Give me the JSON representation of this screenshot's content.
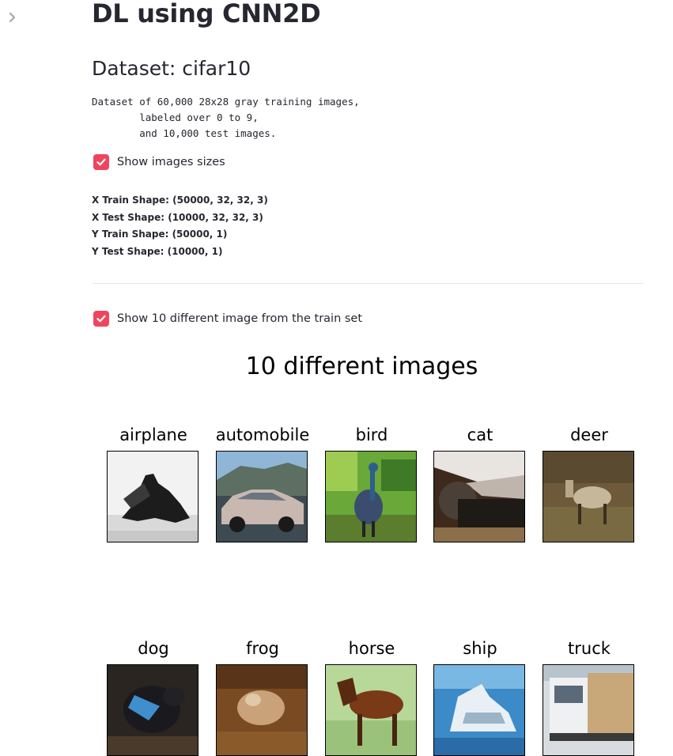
{
  "sidebar": {
    "toggle_icon": "chevron-right-icon"
  },
  "page": {
    "title": "DL using CNN2D",
    "dataset_heading": "Dataset: cifar10",
    "description": "Dataset of 60,000 28x28 gray training images,\n        labeled over 0 to 9,\n        and 10,000 test images."
  },
  "checkbox_sizes": {
    "label": "Show images sizes",
    "checked": true
  },
  "shapes": [
    "X Train Shape: (50000, 32, 32, 3)",
    "X Test Shape: (10000, 32, 32, 3)",
    "Y Train Shape: (50000, 1)",
    "Y Test Shape: (10000, 1)"
  ],
  "checkbox_images": {
    "label": "Show 10 different image from the train set",
    "checked": true
  },
  "figure": {
    "title": "10 different images",
    "images": [
      {
        "label": "airplane"
      },
      {
        "label": "automobile"
      },
      {
        "label": "bird"
      },
      {
        "label": "cat"
      },
      {
        "label": "deer"
      },
      {
        "label": "dog"
      },
      {
        "label": "frog"
      },
      {
        "label": "horse"
      },
      {
        "label": "ship"
      },
      {
        "label": "truck"
      }
    ]
  },
  "colors": {
    "checkbox_accent": "#f0445e",
    "text": "#262730"
  }
}
